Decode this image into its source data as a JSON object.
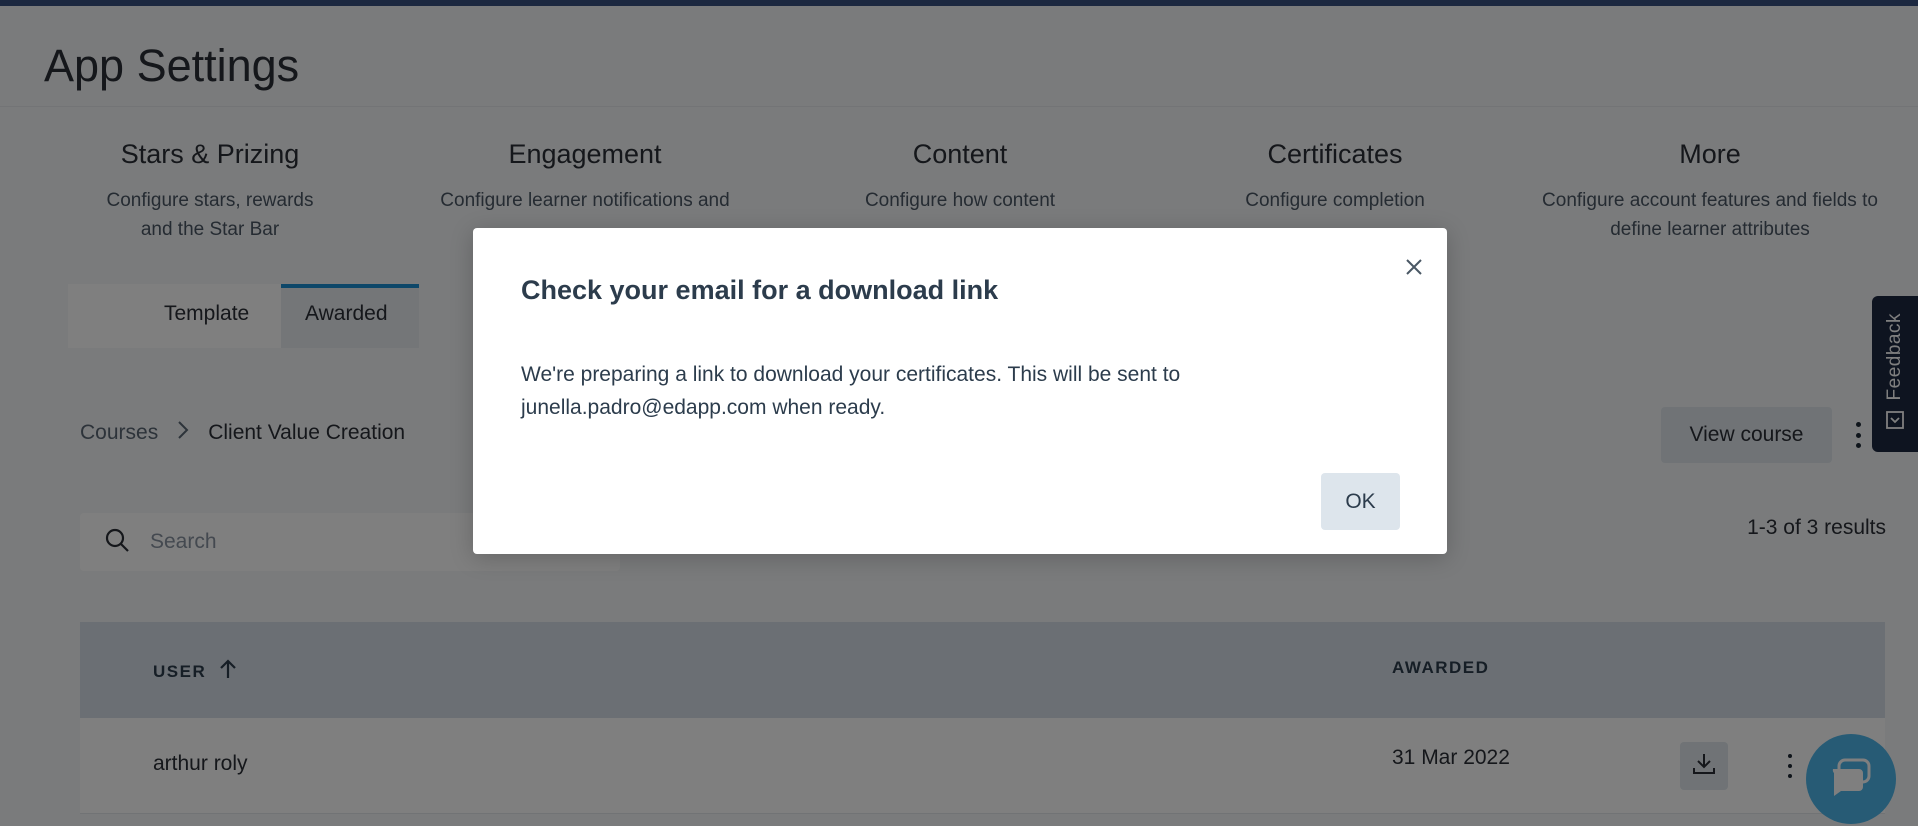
{
  "page": {
    "title": "App Settings"
  },
  "cards": [
    {
      "title": "Stars & Prizing",
      "desc": "Configure stars, rewards and the Star Bar"
    },
    {
      "title": "Engagement",
      "desc": "Configure learner notifications and"
    },
    {
      "title": "Content",
      "desc": "Configure how content"
    },
    {
      "title": "Certificates",
      "desc": "Configure completion"
    },
    {
      "title": "More",
      "desc": "Configure account features and fields to define learner attributes"
    }
  ],
  "tabs": [
    {
      "label": "Template"
    },
    {
      "label": "Awarded"
    }
  ],
  "breadcrumb": {
    "parent": "Courses",
    "current": "Client Value Creation"
  },
  "actions": {
    "view_course": "View course"
  },
  "search": {
    "placeholder": "Search"
  },
  "results": {
    "text": "1-3 of 3 results"
  },
  "table": {
    "columns": {
      "user": "USER",
      "awarded": "AWARDED"
    },
    "rows": [
      {
        "user": "arthur roly",
        "awarded": "31 Mar 2022"
      }
    ]
  },
  "feedback": {
    "label": "Feedback"
  },
  "modal": {
    "title": "Check your email for a download link",
    "body_line1": "We're preparing a link to download your certificates. This will be sent to",
    "body_line2": "junella.padro@edapp.com when ready.",
    "ok_label": "OK"
  },
  "colors": {
    "accent": "#1b8fd3",
    "topbar": "#1c2840",
    "chat": "#4fb6ea",
    "overlay": "rgba(0,0,0,0.5)"
  }
}
